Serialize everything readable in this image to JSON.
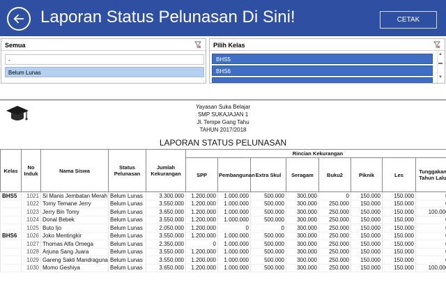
{
  "header": {
    "title": "Laporan Status Pelunasan Di Sini!",
    "cetak_label": "CETAK"
  },
  "slicer_status": {
    "label": "Semua",
    "items": [
      "-",
      "Belum Lunas"
    ]
  },
  "slicer_kelas": {
    "label": "Pilih Kelas",
    "items": [
      "BHS5",
      "BHS6"
    ]
  },
  "report": {
    "org_lines": [
      "Yayasan Suka Belajar",
      "SMP SUKAJAJAN 1",
      "Jl. Tempe Gang Tahu",
      "TAHUN 2017/2018"
    ],
    "title": "LAPORAN STATUS PELUNASAN",
    "group_header": "Rincian Kekurangan",
    "columns": [
      "Kelas",
      "No Induk",
      "Nama Siswa",
      "Status Pelunasan",
      "Jumlah Kekurangan",
      "SPP",
      "Pembangunan",
      "Extra Skul",
      "Seragam",
      "Buku2",
      "Piknik",
      "Les",
      "Tunggakan Tahun Lalu"
    ],
    "rows": [
      {
        "kelas": "BHS5",
        "no": "1021",
        "nama": "Si Manis Jembatan Merah",
        "status": "Belum Lunas",
        "jumlah": "3.300.000",
        "spp": "1.200.000",
        "pemb": "1.000.000",
        "extra": "500.000",
        "seragam": "300.000",
        "buku": "0",
        "piknik": "150.000",
        "les": "150.000",
        "tunggakan": "0"
      },
      {
        "kelas": "",
        "no": "1022",
        "nama": "Tomy Temane Jerry",
        "status": "Belum Lunas",
        "jumlah": "3.550.000",
        "spp": "1.200.000",
        "pemb": "1.000.000",
        "extra": "500.000",
        "seragam": "300.000",
        "buku": "250.000",
        "piknik": "150.000",
        "les": "150.000",
        "tunggakan": "0"
      },
      {
        "kelas": "",
        "no": "1023",
        "nama": "Jerry Bin Tomy",
        "status": "Belum Lunas",
        "jumlah": "3.650.000",
        "spp": "1.200.000",
        "pemb": "1.000.000",
        "extra": "500.000",
        "seragam": "300.000",
        "buku": "250.000",
        "piknik": "150.000",
        "les": "150.000",
        "tunggakan": "100.000"
      },
      {
        "kelas": "",
        "no": "1024",
        "nama": "Donal Bebek",
        "status": "Belum Lunas",
        "jumlah": "3.550.000",
        "spp": "1.200.000",
        "pemb": "1.000.000",
        "extra": "500.000",
        "seragam": "300.000",
        "buku": "250.000",
        "piknik": "150.000",
        "les": "150.000",
        "tunggakan": "0"
      },
      {
        "kelas": "",
        "no": "1025",
        "nama": "Buto Ijo",
        "status": "Belum Lunas",
        "jumlah": "2.050.000",
        "spp": "1.200.000",
        "pemb": "0",
        "extra": "0",
        "seragam": "300.000",
        "buku": "250.000",
        "piknik": "150.000",
        "les": "150.000",
        "tunggakan": "0"
      },
      {
        "kelas": "BHS6",
        "no": "1026",
        "nama": "Joko Mentingkir",
        "status": "Belum Lunas",
        "jumlah": "3.550.000",
        "spp": "1.200.000",
        "pemb": "1.000.000",
        "extra": "500.000",
        "seragam": "300.000",
        "buku": "250.000",
        "piknik": "150.000",
        "les": "150.000",
        "tunggakan": "0"
      },
      {
        "kelas": "",
        "no": "1027",
        "nama": "Thomas Alfa Omega",
        "status": "Belum Lunas",
        "jumlah": "2.350.000",
        "spp": "0",
        "pemb": "1.000.000",
        "extra": "500.000",
        "seragam": "300.000",
        "buku": "250.000",
        "piknik": "150.000",
        "les": "150.000",
        "tunggakan": "0"
      },
      {
        "kelas": "",
        "no": "1028",
        "nama": "Arjuna Sang Juara",
        "status": "Belum Lunas",
        "jumlah": "3.550.000",
        "spp": "1.200.000",
        "pemb": "1.000.000",
        "extra": "500.000",
        "seragam": "300.000",
        "buku": "250.000",
        "piknik": "150.000",
        "les": "150.000",
        "tunggakan": "0"
      },
      {
        "kelas": "",
        "no": "1029",
        "nama": "Gareng Sakti Mandraguna",
        "status": "Belum Lunas",
        "jumlah": "3.550.000",
        "spp": "1.200.000",
        "pemb": "1.000.000",
        "extra": "500.000",
        "seragam": "300.000",
        "buku": "250.000",
        "piknik": "150.000",
        "les": "150.000",
        "tunggakan": "0"
      },
      {
        "kelas": "",
        "no": "1030",
        "nama": "Momo Geshiya",
        "status": "Belum Lunas",
        "jumlah": "3.650.000",
        "spp": "1.200.000",
        "pemb": "1.000.000",
        "extra": "500.000",
        "seragam": "300.000",
        "buku": "250.000",
        "piknik": "150.000",
        "les": "150.000",
        "tunggakan": "100.000"
      }
    ]
  },
  "colors": {
    "header_bg": "#2f4fa2",
    "slicer_selected": "#3f6fc4",
    "slicer_light": "#b5cff0"
  }
}
